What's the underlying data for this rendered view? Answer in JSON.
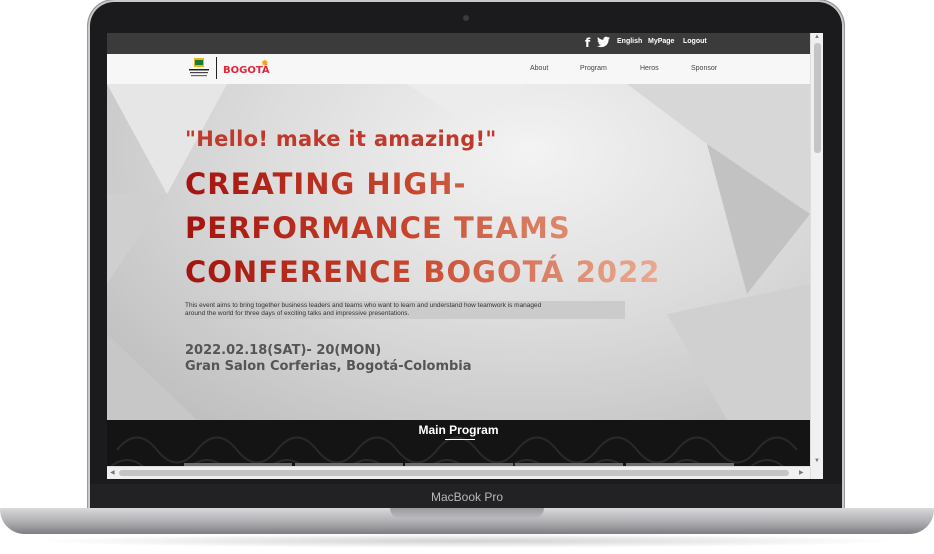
{
  "device": {
    "label": "MacBook Pro"
  },
  "topbar": {
    "facebook_icon": "facebook-icon",
    "twitter_icon": "twitter-icon",
    "links": [
      "English",
      "MyPage",
      "Logout"
    ]
  },
  "navbar": {
    "logo_text": "BOGOTÁ",
    "items": [
      "About",
      "Program",
      "Heros",
      "Sponsor"
    ]
  },
  "hero": {
    "tagline": "\"Hello! make it amazing!\"",
    "title_lines": [
      "CREATING HIGH-",
      "PERFORMANCE TEAMS",
      "CONFERENCE BOGOTÁ 2022"
    ],
    "description_lines": [
      "This event aims to bring together business leaders and teams who want to learn and understand how teamwork is managed",
      "around the world for three days of exciting talks and impressive presentations."
    ],
    "date": "2022.02.18(SAT)- 20(MON)",
    "venue": "Gran Salon Corferias, Bogotá-Colombia"
  },
  "program": {
    "title": "Main Program"
  },
  "colors": {
    "title_red": "#a4130e",
    "logo_red": "#e3253c",
    "topbar_bg": "#3b3b3b",
    "program_bg": "#141414"
  }
}
